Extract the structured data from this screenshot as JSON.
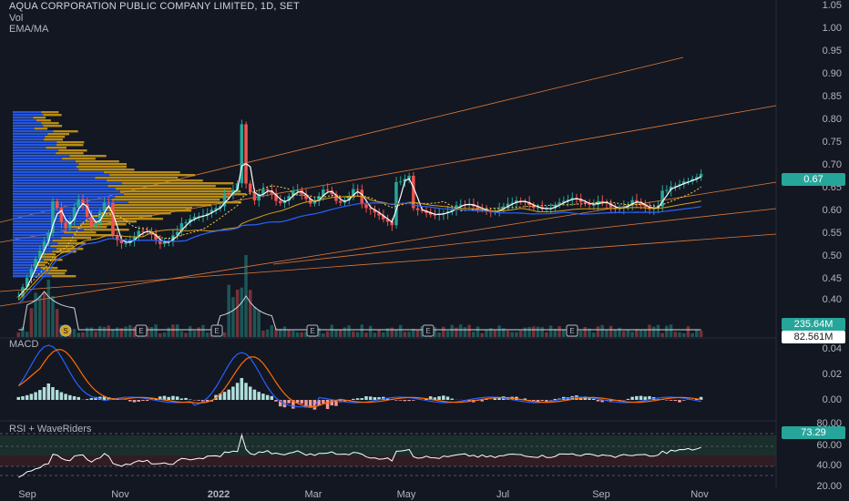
{
  "header": {
    "title": "AQUA CORPORATION PUBLIC COMPANY LIMITED, 1D, SET",
    "vol_label": "Vol",
    "ema_label": "EMA/MA"
  },
  "price_axis": {
    "ticks": [
      "1.05",
      "1.00",
      "0.95",
      "0.90",
      "0.85",
      "0.80",
      "0.75",
      "0.70",
      "0.65",
      "0.60",
      "0.55",
      "0.50",
      "0.45",
      "0.40"
    ],
    "last_price": "0.67",
    "last_price_color": "#26a69a"
  },
  "volume_tags": {
    "vol": "235.64M",
    "vol_ma": "82.561M",
    "vol_color": "#26a69a"
  },
  "macd": {
    "label": "MACD",
    "ticks": [
      "0.04",
      "0.02",
      "0.00"
    ]
  },
  "rsi": {
    "label": "RSI + WaveRiders",
    "ticks": [
      "80.00",
      "60.00",
      "40.00",
      "20.00"
    ],
    "value": "73.29",
    "tag_color": "#26a69a"
  },
  "time_axis": {
    "labels": [
      "Sep",
      "Nov",
      "2022",
      "Mar",
      "May",
      "Jul",
      "Sep",
      "Nov"
    ]
  },
  "event_markers": [
    "S",
    "E",
    "E",
    "E",
    "E",
    "E"
  ],
  "colors": {
    "up": "#26a69a",
    "down": "#ef5350",
    "vp_up": "#2962ff",
    "vp_down": "#d4a017",
    "ema_fast": "#ffffff",
    "ema_slow": "#2962ff",
    "macd_line": "#2962ff",
    "signal_line": "#ff6d00"
  }
}
